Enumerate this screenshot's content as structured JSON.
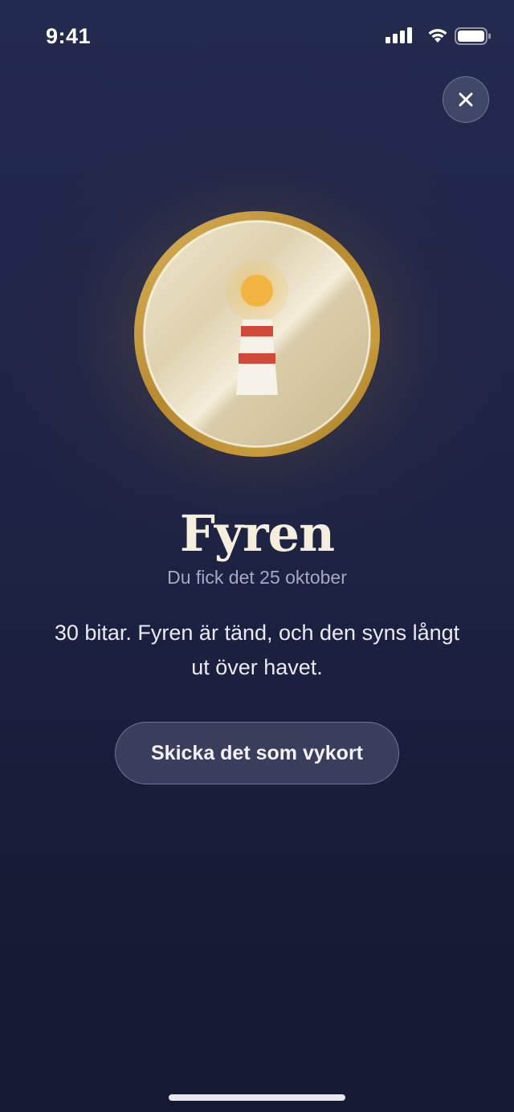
{
  "status_bar": {
    "time": "9:41"
  },
  "close_button": {
    "icon": "close-icon"
  },
  "badge": {
    "icon": "lighthouse-icon",
    "title": "Fyren",
    "date_line": "Du fick det 25 oktober",
    "description": "30 bitar. Fyren är tänd, och den syns långt ut över havet."
  },
  "actions": {
    "send_postcard_label": "Skicka det som vykort"
  },
  "colors": {
    "background": "#1f2548",
    "medal_gold": "#c89b3c",
    "medal_face": "#e6dcc0",
    "lighthouse_stripe": "#d04a3c",
    "lighthouse_light": "#f2b440"
  }
}
